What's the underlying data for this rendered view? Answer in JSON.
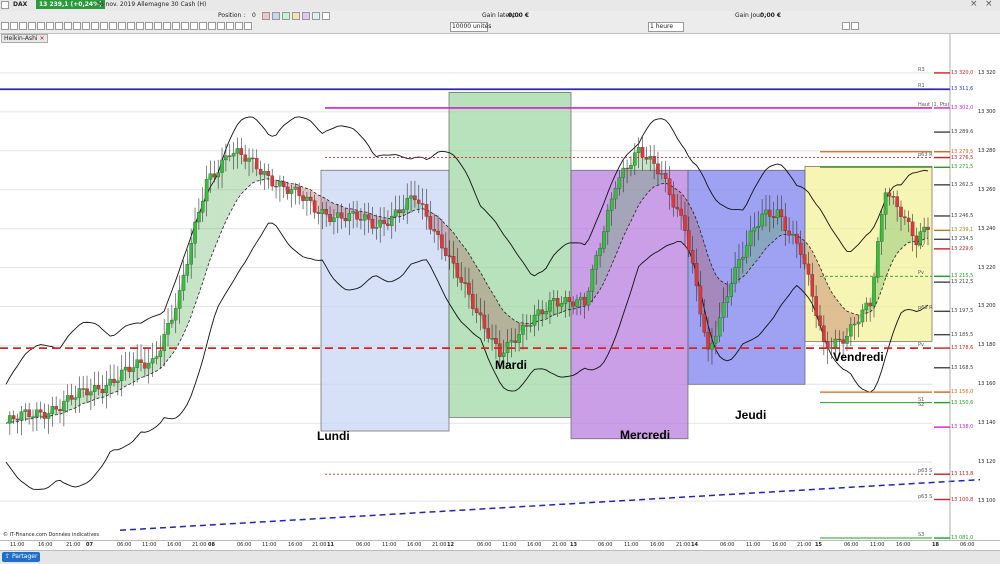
{
  "window": {
    "instrument": "DAX",
    "price_badge": "13 239,1 (+0,24%)",
    "title": "16 nov. 2019 Allemagne 30 Cash (H)"
  },
  "toolbar": {
    "position_label": "Position :",
    "position_value": "0",
    "gain_latent_label": "Gain latent :",
    "gain_latent_value": "0,00 €",
    "gain_jour_label": "Gain Jour :",
    "gain_jour_value": "0,00 €",
    "units_value": "10000 unités",
    "timeframe_value": "1 heure",
    "indicator_tab": "Heikin-Ashi",
    "close_symbol": "×"
  },
  "chart_data": {
    "type": "candlestick",
    "title": "16 nov. 2019 Allemagne 30 Cash (H)",
    "timeframe": "1 heure",
    "ylim": [
      13080,
      13340
    ],
    "days": [
      {
        "label": "Lundi",
        "color": "#c8d6f4",
        "y_range": [
          13136,
          13270
        ]
      },
      {
        "label": "Mardi",
        "color": "#9fd8a6",
        "y_range": [
          13143,
          13310
        ]
      },
      {
        "label": "Mercredi",
        "color": "#b87fe0",
        "y_range": [
          13132,
          13270
        ]
      },
      {
        "label": "Jeudi",
        "color": "#7f82ee",
        "y_range": [
          13160,
          13270
        ]
      },
      {
        "label": "Vendredi",
        "color": "#f4f29a",
        "y_range": [
          13182,
          13272
        ]
      }
    ],
    "x_ticks": [
      "11:00",
      "16:00",
      "21:00",
      "07",
      "06:00",
      "11:00",
      "16:00",
      "21:00",
      "08",
      "06:00",
      "11:00",
      "16:00",
      "21:00",
      "11",
      "06:00",
      "11:00",
      "16:00",
      "21:00",
      "12",
      "06:00",
      "11:00",
      "16:00",
      "21:00",
      "13",
      "06:00",
      "11:00",
      "16:00",
      "21:00",
      "14",
      "06:00",
      "11:00",
      "16:00",
      "21:00",
      "15",
      "06:00",
      "11:00",
      "16:00",
      "18",
      "06:00"
    ],
    "x_ticks_bold": [
      "07",
      "08",
      "11",
      "12",
      "13",
      "14",
      "15",
      "18"
    ],
    "y_ticks": [
      "13 320",
      "13 300",
      "13 280",
      "13 260",
      "13 240",
      "13 220",
      "13 200",
      "13 180",
      "13 160",
      "13 140",
      "13 120",
      "13 100"
    ],
    "price_labels": [
      {
        "text": "13 320,0",
        "y": 13320,
        "color": "#d02020"
      },
      {
        "text": "13 311,6",
        "y": 13311.6,
        "color": "#3030c0"
      },
      {
        "text": "13 302,0",
        "y": 13302,
        "color": "#d020d0"
      },
      {
        "text": "13 289,6",
        "y": 13289.6,
        "color": "#444444"
      },
      {
        "text": "13 279,5",
        "y": 13279.5,
        "color": "#e06010"
      },
      {
        "text": "13 276,5",
        "y": 13276.5,
        "color": "#d02020"
      },
      {
        "text": "13 271,5",
        "y": 13271.5,
        "color": "#20a020"
      },
      {
        "text": "13 262,5",
        "y": 13262.5,
        "color": "#444444"
      },
      {
        "text": "13 246,5",
        "y": 13246.5,
        "color": "#444444"
      },
      {
        "text": "13 239,1",
        "y": 13239.1,
        "color": "#b08000"
      },
      {
        "text": "13 234,5",
        "y": 13234.5,
        "color": "#444444"
      },
      {
        "text": "13 229,6",
        "y": 13229.6,
        "color": "#d02020"
      },
      {
        "text": "13 215,5",
        "y": 13215.5,
        "color": "#20a020"
      },
      {
        "text": "13 212,5",
        "y": 13212.5,
        "color": "#444444"
      },
      {
        "text": "13 197,5",
        "y": 13197.5,
        "color": "#444444"
      },
      {
        "text": "13 185,5",
        "y": 13185.5,
        "color": "#444444"
      },
      {
        "text": "13 178,6",
        "y": 13178.6,
        "color": "#d02020"
      },
      {
        "text": "13 168,5",
        "y": 13168.5,
        "color": "#444444"
      },
      {
        "text": "13 156,0",
        "y": 13156,
        "color": "#e06010"
      },
      {
        "text": "13 150,6",
        "y": 13150.6,
        "color": "#20a020"
      },
      {
        "text": "13 138,0",
        "y": 13138,
        "color": "#d020d0"
      },
      {
        "text": "13 113,8",
        "y": 13113.8,
        "color": "#d02020"
      },
      {
        "text": "13 100,8",
        "y": 13100.8,
        "color": "#d02020"
      },
      {
        "text": "13 081,0",
        "y": 13081,
        "color": "#20a020"
      }
    ],
    "level_tags": [
      {
        "text": "R3",
        "y": 13320
      },
      {
        "text": "R1",
        "y": 13311.6
      },
      {
        "text": "Haut (1, Pts)",
        "y": 13302
      },
      {
        "text": "p63 R",
        "y": 13276.5
      },
      {
        "text": "Pv",
        "y": 13229.6
      },
      {
        "text": "Pv",
        "y": 13215.5
      },
      {
        "text": "p63 R",
        "y": 13197.5
      },
      {
        "text": "Pv",
        "y": 13178.6
      },
      {
        "text": "S1",
        "y": 13150.6
      },
      {
        "text": "S2",
        "y": 13148
      },
      {
        "text": "p63 S",
        "y": 13113.8
      },
      {
        "text": "p63 S",
        "y": 13100.8
      },
      {
        "text": "S3",
        "y": 13081
      }
    ],
    "price_line": 13239.1,
    "grid": true
  },
  "status": {
    "share_button": "Partager",
    "footer_note": "© IT-Finance.com  Données indicatives"
  }
}
